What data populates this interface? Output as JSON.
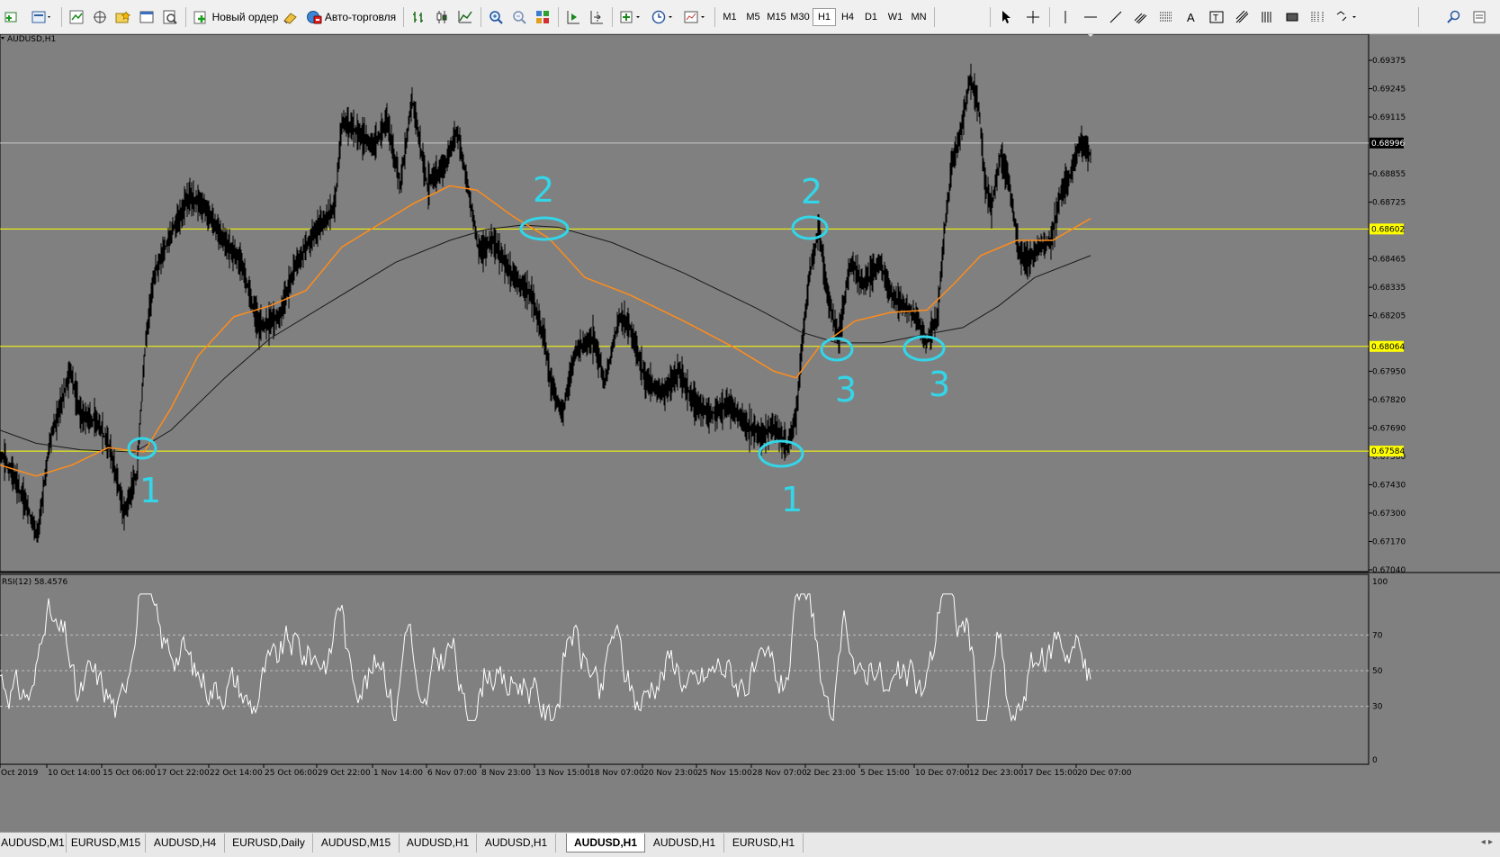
{
  "toolbar": {
    "new_order_label": "Новый ордер",
    "autotrading_label": "Авто-торговля",
    "timeframes": [
      {
        "label": "M1",
        "active": false
      },
      {
        "label": "M5",
        "active": false
      },
      {
        "label": "M15",
        "active": false
      },
      {
        "label": "M30",
        "active": false
      },
      {
        "label": "H1",
        "active": true
      },
      {
        "label": "H4",
        "active": false
      },
      {
        "label": "D1",
        "active": false
      },
      {
        "label": "W1",
        "active": false
      },
      {
        "label": "MN",
        "active": false
      }
    ]
  },
  "chart": {
    "symbol_label": "AUDUSD,H1",
    "price_axis": [
      "0.69375",
      "0.69245",
      "0.69115",
      "0.68855",
      "0.68725",
      "0.68465",
      "0.68335",
      "0.68205",
      "0.67950",
      "0.67820",
      "0.67690",
      "0.67560",
      "0.67430",
      "0.67300",
      "0.67170",
      "0.67040"
    ],
    "current_price": "0.68996",
    "level_lines": [
      {
        "price": "0.68602",
        "color": "#ffff00"
      },
      {
        "price": "0.68064",
        "color": "#ffff00"
      },
      {
        "price": "0.67584",
        "color": "#ffff00"
      }
    ],
    "indicator_label": "RSI(12) 58.4576",
    "rsi_axis": [
      "100",
      "70",
      "50",
      "30",
      "0"
    ],
    "time_axis": [
      "Oct 2019",
      "10 Oct 14:00",
      "15 Oct 06:00",
      "17 Oct 22:00",
      "22 Oct 14:00",
      "25 Oct 06:00",
      "29 Oct 22:00",
      "1 Nov 14:00",
      "6 Nov 07:00",
      "8 Nov 23:00",
      "13 Nov 15:00",
      "18 Nov 07:00",
      "20 Nov 23:00",
      "25 Nov 15:00",
      "28 Nov 07:00",
      "2 Dec 23:00",
      "5 Dec 15:00",
      "10 Dec 07:00",
      "12 Dec 23:00",
      "17 Dec 15:00",
      "20 Dec 07:00"
    ],
    "annotations": [
      "1",
      "2",
      "3",
      "1",
      "2",
      "3"
    ],
    "colors": {
      "background": "#808080",
      "price_line": "#000000",
      "ma_fast": "#ff8c1a",
      "ma_slow": "#1a1a1a",
      "level": "#ffff00",
      "rsi": "#ffffff",
      "markup": "#33d6e8"
    }
  },
  "tabs": [
    {
      "label": "AUDUSD,M1",
      "active": false
    },
    {
      "label": "EURUSD,M15",
      "active": false
    },
    {
      "label": "AUDUSD,H4",
      "active": false
    },
    {
      "label": "EURUSD,Daily",
      "active": false
    },
    {
      "label": "AUDUSD,M15",
      "active": false
    },
    {
      "label": "AUDUSD,H1",
      "active": false
    },
    {
      "label": "AUDUSD,H1",
      "active": false
    },
    {
      "label": "AUDUSD,H1",
      "active": true
    },
    {
      "label": "AUDUSD,H1",
      "active": false
    },
    {
      "label": "EURUSD,H1",
      "active": false
    }
  ]
}
